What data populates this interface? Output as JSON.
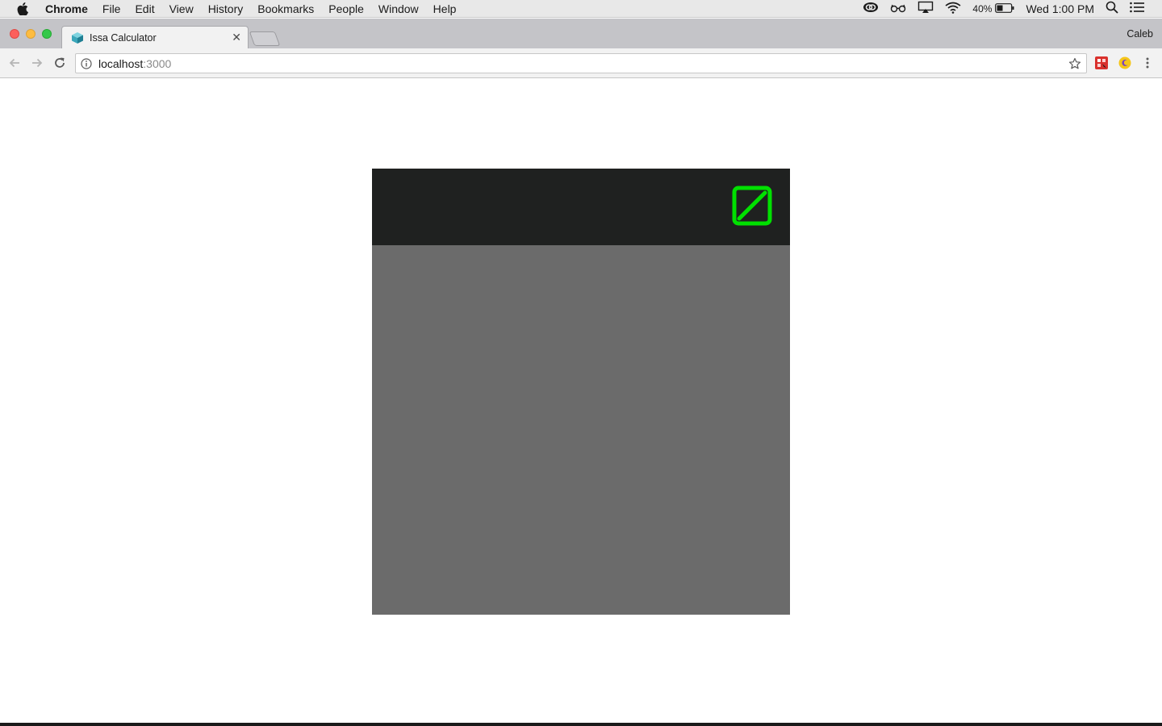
{
  "menubar": {
    "app_name": "Chrome",
    "items": [
      "File",
      "Edit",
      "View",
      "History",
      "Bookmarks",
      "People",
      "Window",
      "Help"
    ],
    "battery": "40%",
    "clock": "Wed 1:00 PM"
  },
  "browser": {
    "tab_title": "Issa Calculator",
    "profile_name": "Caleb",
    "url_host": "localhost",
    "url_port": ":3000"
  },
  "calculator": {
    "header_color": "#1f2120",
    "body_color": "#6b6b6b",
    "icon_color": "#00e000",
    "icon_name": "square-slash-icon"
  }
}
